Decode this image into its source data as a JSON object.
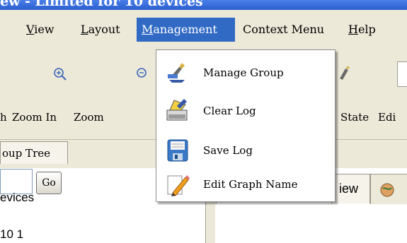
{
  "window": {
    "title": "ew - Limited for 10 devices"
  },
  "menubar": {
    "items": [
      {
        "mnemonic": "V",
        "rest": "iew"
      },
      {
        "mnemonic": "L",
        "rest": "ayout"
      },
      {
        "mnemonic": "M",
        "rest": "anagement"
      },
      {
        "label": "Context Menu"
      },
      {
        "mnemonic": "H",
        "rest": "elp"
      }
    ]
  },
  "toolbar": {
    "labels": [
      "h",
      "Zoom In",
      "Zoom",
      "State",
      "Edi"
    ]
  },
  "tabs": {
    "group_tree": "oup Tree",
    "view": "iew"
  },
  "search": {
    "value": "",
    "go_label": "Go"
  },
  "tree": {
    "devices_label": "evices",
    "partial_label": "10 1"
  },
  "dropdown": {
    "items": [
      {
        "label": "Manage Group",
        "icon": "manage-group-icon"
      },
      {
        "label": "Clear Log",
        "icon": "clear-log-icon"
      },
      {
        "label": "Save Log",
        "icon": "floppy-disk-icon"
      },
      {
        "label": "Edit Graph Name",
        "icon": "pencil-icon"
      }
    ]
  },
  "colors": {
    "menu_highlight": "#316ac5",
    "chrome": "#ece9d8"
  }
}
